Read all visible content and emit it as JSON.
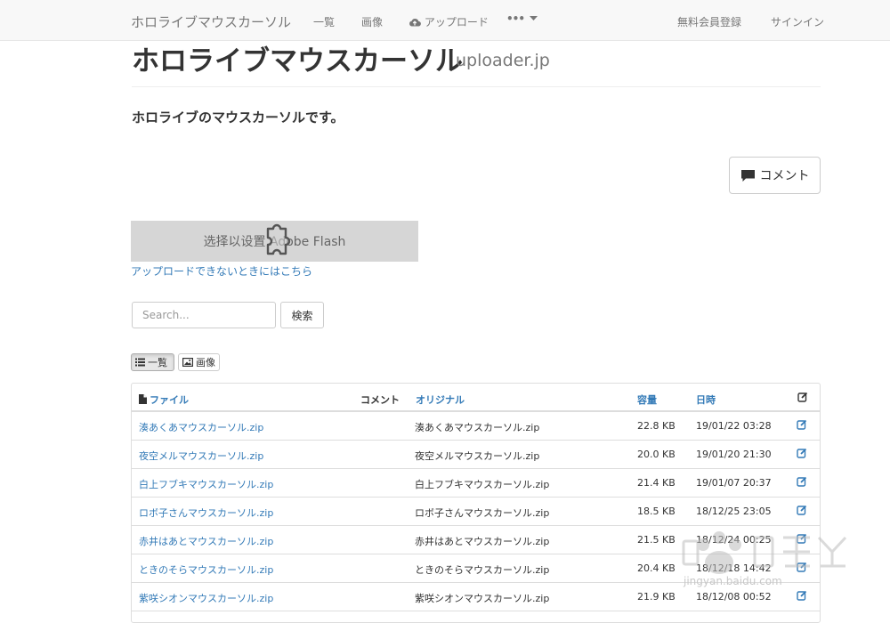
{
  "navbar": {
    "brand": "ホロライブマウスカーソル",
    "links": [
      "一覧",
      "画像",
      "アップロード"
    ],
    "more": "•••",
    "signup": "無料会員登録",
    "signin": "サインイン"
  },
  "header": {
    "title": "ホロライブマウスカーソル",
    "subtitle": "uploader.jp",
    "description": "ホロライブのマウスカーソルです。"
  },
  "comment_button": "コメント",
  "flash": {
    "label": "选择以设置 Adobe Flash",
    "upload_fallback": "アップロードできないときにはこちら"
  },
  "search": {
    "placeholder": "Search...",
    "button": "検索"
  },
  "view_toggle": {
    "list": "一覧",
    "image": "画像"
  },
  "table": {
    "headers": {
      "file": "ファイル",
      "comment": "コメント",
      "original": "オリジナル",
      "size": "容量",
      "date": "日時"
    },
    "rows": [
      {
        "file": "湊あくあマウスカーソル.zip",
        "original": "湊あくあマウスカーソル.zip",
        "size": "22.8 KB",
        "date": "19/01/22 03:28"
      },
      {
        "file": "夜空メルマウスカーソル.zip",
        "original": "夜空メルマウスカーソル.zip",
        "size": "20.0 KB",
        "date": "19/01/20 21:30"
      },
      {
        "file": "白上フブキマウスカーソル.zip",
        "original": "白上フブキマウスカーソル.zip",
        "size": "21.4 KB",
        "date": "19/01/07 20:37"
      },
      {
        "file": "ロボ子さんマウスカーソル.zip",
        "original": "ロボ子さんマウスカーソル.zip",
        "size": "18.5 KB",
        "date": "18/12/25 23:05"
      },
      {
        "file": "赤井はあとマウスカーソル.zip",
        "original": "赤井はあとマウスカーソル.zip",
        "size": "21.5 KB",
        "date": "18/12/24 00:25"
      },
      {
        "file": "ときのそらマウスカーソル.zip",
        "original": "ときのそらマウスカーソル.zip",
        "size": "20.4 KB",
        "date": "18/12/18 14:42"
      },
      {
        "file": "紫咲シオンマウスカーソル.zip",
        "original": "紫咲シオンマウスカーソル.zip",
        "size": "21.9 KB",
        "date": "18/12/08 00:52"
      }
    ]
  },
  "watermark": {
    "text": "jingyan.baidu.com"
  },
  "colors": {
    "link": "#337ab7",
    "navbar_bg": "#f8f8f8",
    "flash_bg": "#d6d6d6"
  }
}
